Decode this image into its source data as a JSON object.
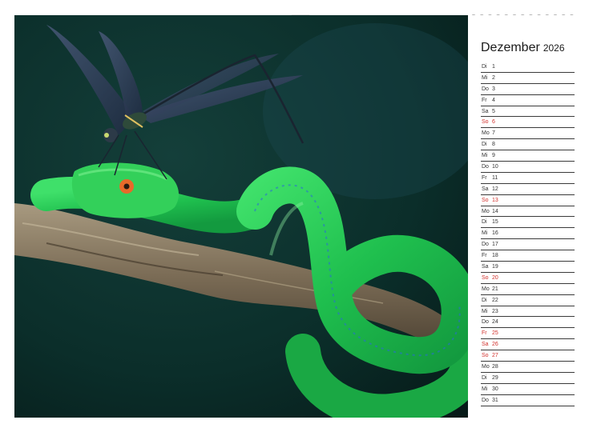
{
  "calendar": {
    "month": "Dezember",
    "year": "2026",
    "accent_color": "#d2322d",
    "days": [
      {
        "wd": "Di",
        "d": "1",
        "red": false
      },
      {
        "wd": "Mi",
        "d": "2",
        "red": false
      },
      {
        "wd": "Do",
        "d": "3",
        "red": false
      },
      {
        "wd": "Fr",
        "d": "4",
        "red": false
      },
      {
        "wd": "Sa",
        "d": "5",
        "red": false
      },
      {
        "wd": "So",
        "d": "6",
        "red": true
      },
      {
        "wd": "Mo",
        "d": "7",
        "red": false
      },
      {
        "wd": "Di",
        "d": "8",
        "red": false
      },
      {
        "wd": "Mi",
        "d": "9",
        "red": false
      },
      {
        "wd": "Do",
        "d": "10",
        "red": false
      },
      {
        "wd": "Fr",
        "d": "11",
        "red": false
      },
      {
        "wd": "Sa",
        "d": "12",
        "red": false
      },
      {
        "wd": "So",
        "d": "13",
        "red": true
      },
      {
        "wd": "Mo",
        "d": "14",
        "red": false
      },
      {
        "wd": "Di",
        "d": "15",
        "red": false
      },
      {
        "wd": "Mi",
        "d": "16",
        "red": false
      },
      {
        "wd": "Do",
        "d": "17",
        "red": false
      },
      {
        "wd": "Fr",
        "d": "18",
        "red": false
      },
      {
        "wd": "Sa",
        "d": "19",
        "red": false
      },
      {
        "wd": "So",
        "d": "20",
        "red": true
      },
      {
        "wd": "Mo",
        "d": "21",
        "red": false
      },
      {
        "wd": "Di",
        "d": "22",
        "red": false
      },
      {
        "wd": "Mi",
        "d": "23",
        "red": false
      },
      {
        "wd": "Do",
        "d": "24",
        "red": false
      },
      {
        "wd": "Fr",
        "d": "25",
        "red": true
      },
      {
        "wd": "Sa",
        "d": "26",
        "red": true
      },
      {
        "wd": "So",
        "d": "27",
        "red": true
      },
      {
        "wd": "Mo",
        "d": "28",
        "red": false
      },
      {
        "wd": "Di",
        "d": "29",
        "red": false
      },
      {
        "wd": "Mi",
        "d": "30",
        "red": false
      },
      {
        "wd": "Do",
        "d": "31",
        "red": false
      }
    ]
  },
  "photo": {
    "subject": "green pit viper with damselfly",
    "snake_color": "#2ecc4a",
    "background_color": "#0b2e2a"
  }
}
